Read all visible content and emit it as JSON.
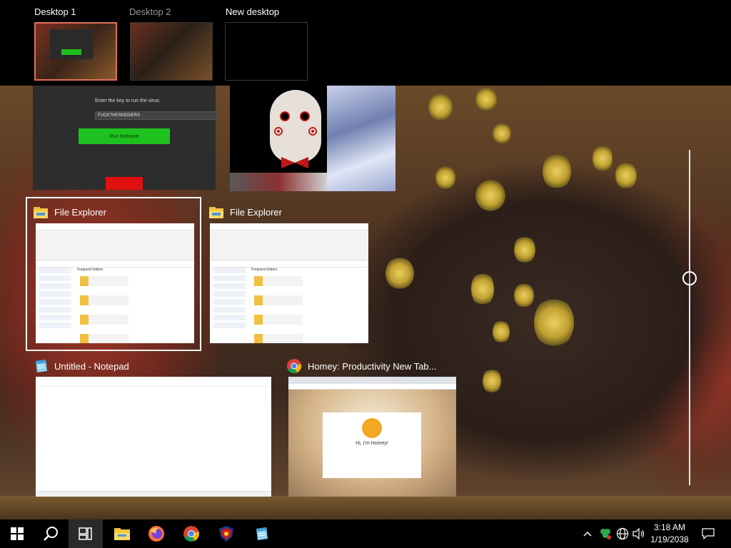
{
  "desktops": [
    {
      "label": "Desktop 1",
      "active": true
    },
    {
      "label": "Desktop 2",
      "active": false
    },
    {
      "label": "New desktop",
      "active": false
    }
  ],
  "windows": {
    "virus_app": {
      "prompt": "Enter the key to run the virus:",
      "key_value": "FUCKTHESKIDDERS",
      "button_label": "Run Malware"
    },
    "file_explorer_1": {
      "title": "File Explorer",
      "section": "Frequent folders",
      "selected": true
    },
    "file_explorer_2": {
      "title": "File Explorer",
      "section": "Frequent folders",
      "selected": false
    },
    "notepad": {
      "title": "Untitled - Notepad"
    },
    "chrome": {
      "title": "Homey: Productivity New Tab...",
      "greeting": "Hi, I'm Homey!"
    }
  },
  "taskbar": {
    "apps": [
      "start-icon",
      "search-icon",
      "task-view-icon",
      "file-explorer-icon",
      "firefox-icon",
      "chrome-icon",
      "shield-app-icon",
      "notepad-icon"
    ],
    "time": "3:18 AM",
    "date": "1/19/2038"
  },
  "colors": {
    "accent_active": "#e0705a",
    "green_button": "#1ec21e",
    "red_button": "#e01010"
  }
}
